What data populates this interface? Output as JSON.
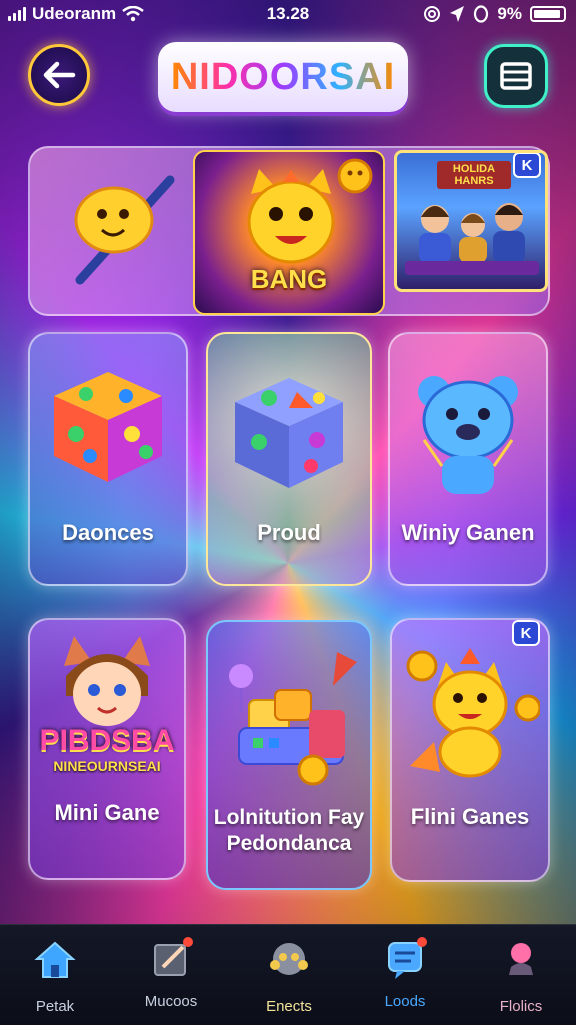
{
  "status_bar": {
    "carrier": "Udeoranm",
    "time": "13.28",
    "battery_percent": "9%",
    "icons": [
      "signal-icon",
      "wifi-icon",
      "at-icon",
      "location-icon",
      "alarm-icon",
      "battery-icon"
    ]
  },
  "header": {
    "title": "NIDOORSAI",
    "back_icon": "arrow-left-icon",
    "menu_icon": "menu-frame-icon"
  },
  "featured": {
    "bang_banner": "BANG",
    "photo_banner": "HOLIDA HANRS",
    "corner_badge": "K"
  },
  "cards": [
    {
      "label": "Daonces",
      "art": "rainbow-dice"
    },
    {
      "label": "Proud",
      "art": "glowing-cube"
    },
    {
      "label": "Winiy Ganen",
      "art": "blue-bear"
    },
    {
      "label": "Mini Gane",
      "art": "cartoon-girl",
      "banner_line1": "PIBDSBA",
      "banner_line2": "NINEOURNSEAI"
    },
    {
      "label_line1": "Lolnitution Fay",
      "label_line2": "Pedondanca",
      "art": "toy-blocks"
    },
    {
      "label": "Flini Ganes",
      "art": "yellow-cat",
      "badge": "K"
    }
  ],
  "bottom_nav": [
    {
      "label": "Petak",
      "icon": "home-icon",
      "color": "#3fa6ff",
      "badge": false
    },
    {
      "label": "Mucoos",
      "icon": "edit-icon",
      "color": "#9aa0b0",
      "badge": true
    },
    {
      "label": "Enects",
      "icon": "mascot-icon",
      "color": "#f2c94c",
      "badge": false
    },
    {
      "label": "Loods",
      "icon": "chat-icon",
      "color": "#4aa8ff",
      "badge": true
    },
    {
      "label": "Flolics",
      "icon": "pin-icon",
      "color": "#ff6fa8",
      "badge": false
    }
  ],
  "colors": {
    "accent_gold": "#ffc93a",
    "accent_teal": "#3ff0c8",
    "nav_bg": "#0b0d18"
  }
}
